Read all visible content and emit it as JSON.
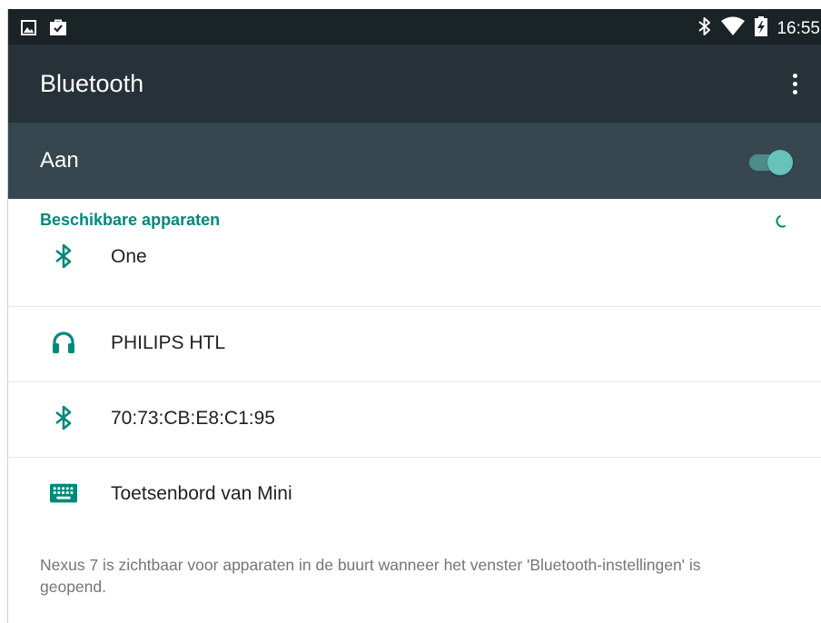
{
  "status_bar": {
    "time": "16:55",
    "left_icons": [
      "image-notification-icon",
      "shopping-bag-notification-icon"
    ],
    "right_icons": [
      "bluetooth-icon",
      "wifi-icon",
      "battery-charging-icon"
    ]
  },
  "app_bar": {
    "title": "Bluetooth",
    "overflow_icon": "more-vert-icon"
  },
  "switch_bar": {
    "label": "Aan",
    "state": "on"
  },
  "available_devices": {
    "header": "Beschikbare apparaten",
    "scanning_indicator": "spinner-icon",
    "devices": [
      {
        "name": "One",
        "icon": "bluetooth-icon"
      },
      {
        "name": "PHILIPS HTL",
        "icon": "headphones-icon"
      },
      {
        "name": "70:73:CB:E8:C1:95",
        "icon": "bluetooth-icon"
      },
      {
        "name": "Toetsenbord van Mini",
        "icon": "keyboard-icon"
      }
    ]
  },
  "footer": {
    "visibility_text": "Nexus 7 is zichtbaar voor apparaten in de buurt wanneer het venster 'Bluetooth-instellingen' is geopend."
  },
  "colors": {
    "status_bar_bg": "#1a2326",
    "app_bar_bg": "#263238",
    "switch_bar_bg": "#37474f",
    "accent": "#00897b",
    "toggle_thumb": "#67c2b9"
  }
}
